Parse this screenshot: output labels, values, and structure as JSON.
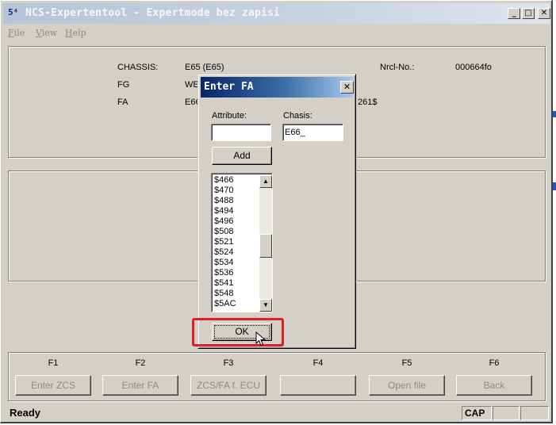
{
  "window": {
    "title": "NCS-Expertentool - Expertmode bez zapisi",
    "icon": "ncs-app-icon",
    "controls": {
      "minimize": "_",
      "maximize": "□",
      "close": "✕"
    }
  },
  "menu": {
    "file": {
      "key": "F",
      "rest": "ile"
    },
    "view": {
      "key": "V",
      "rest": "iew"
    },
    "help": {
      "key": "H",
      "rest": "elp"
    }
  },
  "info": {
    "chassis_label": "CHASSIS:",
    "chassis_value": "E65 (E65)",
    "fg_label": "FG",
    "fg_value": "WE",
    "fa_label": "FA",
    "fa_value": "E66",
    "fa_value_tail": "261$",
    "nrcl_label": "Nrcl-No.:",
    "nrcl_value": "000664fo"
  },
  "function_keys": [
    {
      "key": "F1",
      "label": "Enter ZCS"
    },
    {
      "key": "F2",
      "label": "Enter FA"
    },
    {
      "key": "F3",
      "label": "ZCS/FA f. ECU"
    },
    {
      "key": "F4",
      "label": ""
    },
    {
      "key": "F5",
      "label": "Open file"
    },
    {
      "key": "F6",
      "label": "Back"
    }
  ],
  "status": {
    "ready": "Ready",
    "cap": "CAP"
  },
  "dialog": {
    "title": "Enter FA",
    "close": "✕",
    "attribute_label": "Attribute:",
    "attribute_value": "",
    "chassis_label": "Chasis:",
    "chassis_value": "E66_",
    "add_button": "Add",
    "ok_button": "OK",
    "list_items": [
      "$466",
      "$470",
      "$488",
      "$494",
      "$496",
      "$508",
      "$521",
      "$524",
      "$534",
      "$536",
      "$541",
      "$548",
      "$5AC"
    ],
    "scroll_up": "▲",
    "scroll_down": "▼"
  },
  "colors": {
    "highlight": "#e02020"
  }
}
